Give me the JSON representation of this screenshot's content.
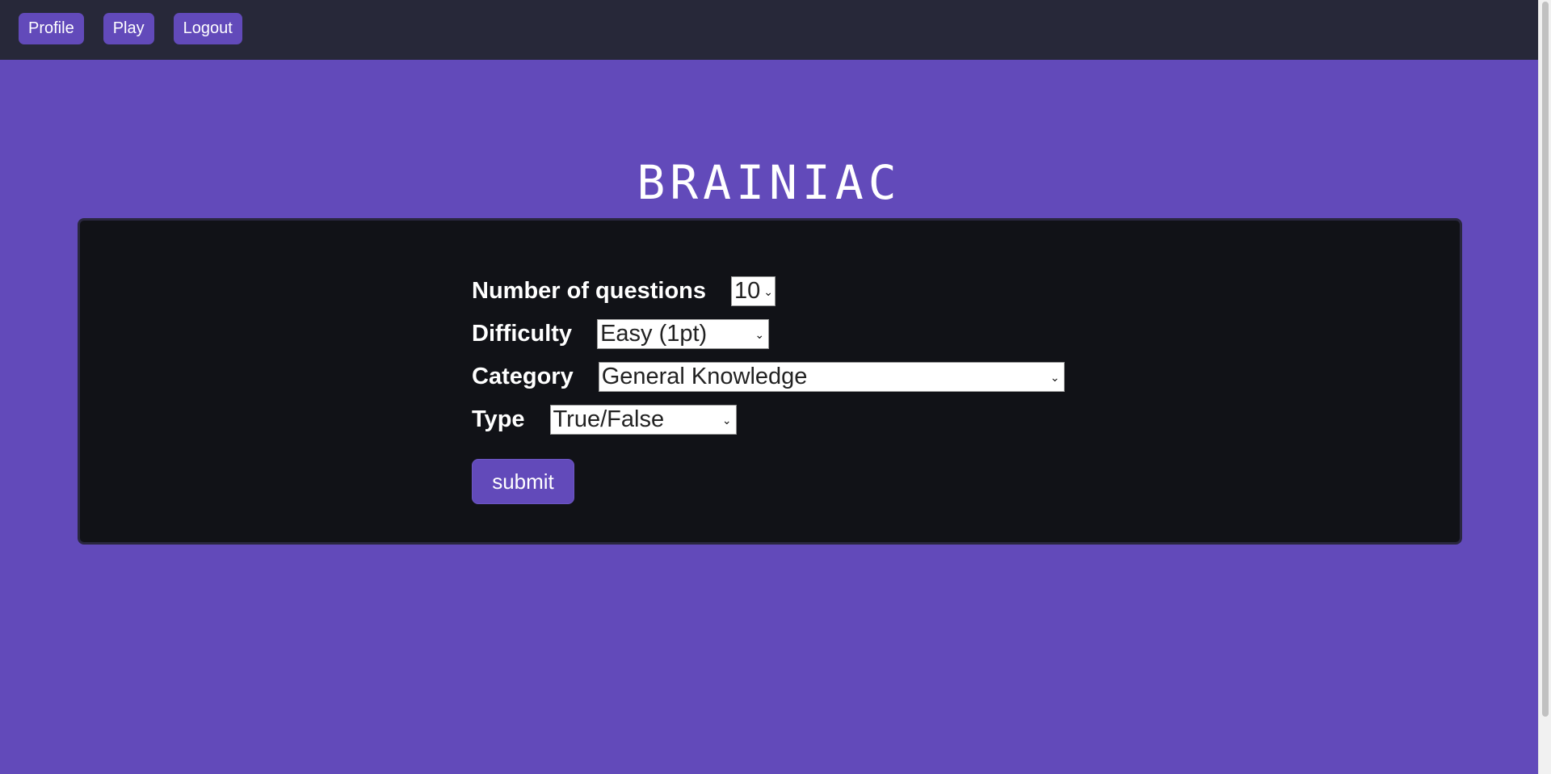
{
  "nav": {
    "profile_label": "Profile",
    "play_label": "Play",
    "logout_label": "Logout"
  },
  "brand": {
    "title": "BRAINIAC"
  },
  "form": {
    "questions": {
      "label": "Number of questions",
      "value": "10"
    },
    "difficulty": {
      "label": "Difficulty",
      "value": "Easy (1pt)"
    },
    "category": {
      "label": "Category",
      "value": "General Knowledge"
    },
    "type": {
      "label": "Type",
      "value": "True/False"
    },
    "submit_label": "submit"
  },
  "colors": {
    "page_bg": "#624aba",
    "topbar_bg": "#272839",
    "panel_bg": "#111217",
    "accent": "#624aba"
  },
  "icons": {
    "select_arrow": "chevron-down-icon"
  }
}
